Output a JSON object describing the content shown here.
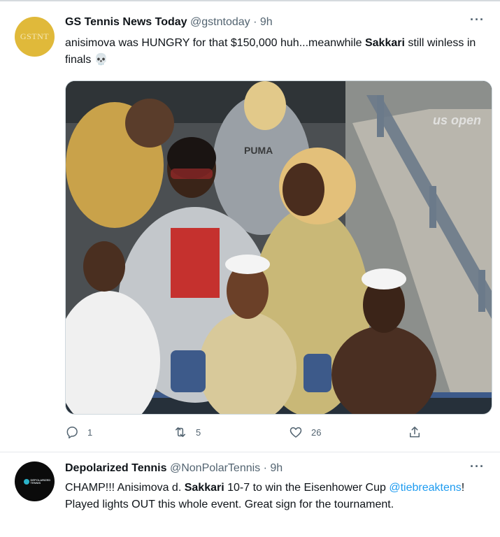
{
  "tweets": [
    {
      "avatar_text": "GSTNT",
      "name": "GS Tennis News Today",
      "handle": "@gstntoday",
      "separator": "·",
      "time": "9h",
      "more": "···",
      "text": {
        "part1": "anisimova was HUNGRY for that $150,000 huh...meanwhile ",
        "bold1": "Sakkari",
        "part2": " still winless in finals",
        "emoji": "💀"
      },
      "media": {
        "watermark": "us open",
        "shirt_text": "PUMA"
      },
      "actions": {
        "reply_count": "1",
        "retweet_count": "5",
        "like_count": "26"
      }
    },
    {
      "avatar_text": "DEPOLARIZED TENNIS",
      "name": "Depolarized Tennis",
      "handle": "@NonPolarTennis",
      "separator": "·",
      "time": "9h",
      "more": "···",
      "text": {
        "part1": "CHAMP!!! Anisimova d. ",
        "bold1": "Sakkari",
        "part2": " 10-7 to win the Eisenhower Cup ",
        "mention": "@tiebreaktens",
        "part3": "! Played lights OUT this whole event. Great sign for the tournament."
      }
    }
  ],
  "colors": {
    "link": "#1d9bf0",
    "muted": "#536471",
    "text": "#0f1419",
    "gold_avatar": "#e0b93a"
  }
}
